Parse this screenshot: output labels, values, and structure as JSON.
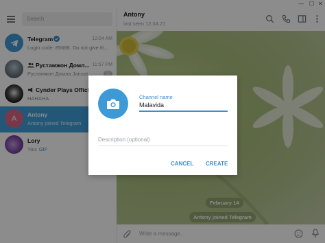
{
  "window": {
    "minimize": "—",
    "maximize": "☐",
    "close": "✕"
  },
  "search": {
    "placeholder": "Search"
  },
  "chats": [
    {
      "name": "Telegram",
      "time": "12:54 AM",
      "preview": "Login code: 85688. Do not give th..."
    },
    {
      "name": "Рустамжон Домл...",
      "time": "11:57 PM",
      "preview": "Рустамжон Домла Jannat...",
      "badge": "50"
    },
    {
      "name": "Cynder Plays Official",
      "time": "",
      "preview": "HAHAHA"
    },
    {
      "name": "Antony",
      "letter": "A",
      "preview": "Antony joined Telegram"
    },
    {
      "name": "Lory",
      "preview_prefix": "You: ",
      "preview": "GIF"
    }
  ],
  "header": {
    "title": "Antony",
    "status": "last seen 12.04.21"
  },
  "messages": {
    "date": "February 14",
    "service": "Antony joined Telegram"
  },
  "composer": {
    "placeholder": "Write a message..."
  },
  "dialog": {
    "name_label": "Channel name",
    "name_value": "Malavida",
    "description_placeholder": "Description (optional)",
    "cancel": "CANCEL",
    "create": "CREATE"
  }
}
